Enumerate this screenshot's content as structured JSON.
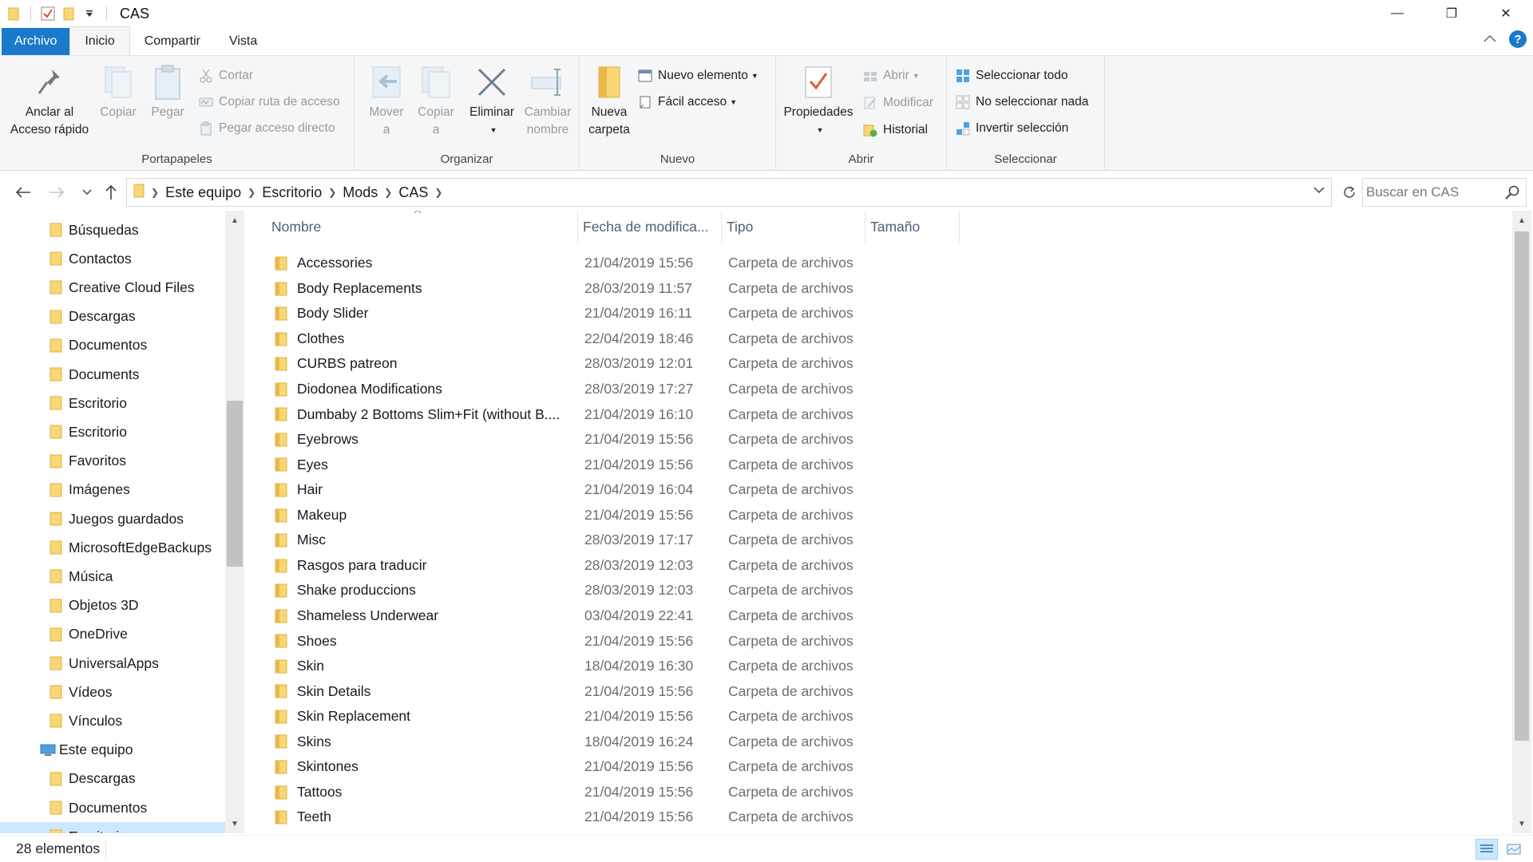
{
  "window": {
    "title": "CAS",
    "controls": {
      "minimize": "—",
      "maximize": "❐",
      "close": "✕"
    }
  },
  "ribbon_tabs": [
    "Archivo",
    "Inicio",
    "Compartir",
    "Vista"
  ],
  "ribbon": {
    "portapapeles": {
      "label": "Portapapeles",
      "pin_line1": "Anclar al",
      "pin_line2": "Acceso rápido",
      "copy": "Copiar",
      "paste": "Pegar",
      "cut": "Cortar",
      "copy_path": "Copiar ruta de acceso",
      "paste_shortcut": "Pegar acceso directo"
    },
    "organizar": {
      "label": "Organizar",
      "move_line1": "Mover",
      "move_line2": "a",
      "copy_line1": "Copiar",
      "copy_line2": "a",
      "delete": "Eliminar",
      "rename_line1": "Cambiar",
      "rename_line2": "nombre"
    },
    "nuevo": {
      "label": "Nuevo",
      "new_folder_line1": "Nueva",
      "new_folder_line2": "carpeta",
      "new_item": "Nuevo elemento",
      "easy_access": "Fácil acceso"
    },
    "abrir": {
      "label": "Abrir",
      "properties": "Propiedades",
      "open": "Abrir",
      "edit": "Modificar",
      "history": "Historial"
    },
    "seleccionar": {
      "label": "Seleccionar",
      "select_all": "Seleccionar todo",
      "select_none": "No seleccionar nada",
      "invert": "Invertir selección"
    }
  },
  "address": {
    "crumbs": [
      "Este equipo",
      "Escritorio",
      "Mods",
      "CAS"
    ],
    "search_placeholder": "Buscar en CAS"
  },
  "sidebar": {
    "items": [
      {
        "label": "Búsquedas",
        "icon": "search-folder-icon"
      },
      {
        "label": "Contactos",
        "icon": "contacts-folder-icon"
      },
      {
        "label": "Creative Cloud Files",
        "icon": "creative-cloud-icon"
      },
      {
        "label": "Descargas",
        "icon": "downloads-folder-icon"
      },
      {
        "label": "Documentos",
        "icon": "documents-folder-icon"
      },
      {
        "label": "Documents",
        "icon": "folder-icon"
      },
      {
        "label": "Escritorio",
        "icon": "desktop-folder-icon"
      },
      {
        "label": "Escritorio",
        "icon": "desktop-folder-icon"
      },
      {
        "label": "Favoritos",
        "icon": "favorites-folder-icon"
      },
      {
        "label": "Imágenes",
        "icon": "pictures-folder-icon"
      },
      {
        "label": "Juegos guardados",
        "icon": "saved-games-folder-icon"
      },
      {
        "label": "MicrosoftEdgeBackups",
        "icon": "folder-icon"
      },
      {
        "label": "Música",
        "icon": "music-folder-icon"
      },
      {
        "label": "Objetos 3D",
        "icon": "3d-objects-folder-icon"
      },
      {
        "label": "OneDrive",
        "icon": "onedrive-folder-icon"
      },
      {
        "label": "UniversalApps",
        "icon": "folder-icon"
      },
      {
        "label": "Vídeos",
        "icon": "videos-folder-icon"
      },
      {
        "label": "Vínculos",
        "icon": "links-folder-icon"
      },
      {
        "label": "Este equipo",
        "icon": "this-pc-icon"
      },
      {
        "label": "Descargas",
        "icon": "downloads-folder-icon"
      },
      {
        "label": "Documentos",
        "icon": "documents-folder-icon"
      },
      {
        "label": "Escritorio",
        "icon": "desktop-folder-icon"
      }
    ]
  },
  "columns": [
    "Nombre",
    "Fecha de modifica...",
    "Tipo",
    "Tamaño"
  ],
  "files": [
    {
      "name": "Accessories",
      "date": "21/04/2019 15:56",
      "type": "Carpeta de archivos"
    },
    {
      "name": "Body Replacements",
      "date": "28/03/2019 11:57",
      "type": "Carpeta de archivos"
    },
    {
      "name": "Body Slider",
      "date": "21/04/2019 16:11",
      "type": "Carpeta de archivos"
    },
    {
      "name": "Clothes",
      "date": "22/04/2019 18:46",
      "type": "Carpeta de archivos"
    },
    {
      "name": "CURBS patreon",
      "date": "28/03/2019 12:01",
      "type": "Carpeta de archivos"
    },
    {
      "name": "Diodonea Modifications",
      "date": "28/03/2019 17:27",
      "type": "Carpeta de archivos"
    },
    {
      "name": "Dumbaby 2 Bottoms Slim+Fit (without B....",
      "date": "21/04/2019 16:10",
      "type": "Carpeta de archivos"
    },
    {
      "name": "Eyebrows",
      "date": "21/04/2019 15:56",
      "type": "Carpeta de archivos"
    },
    {
      "name": "Eyes",
      "date": "21/04/2019 15:56",
      "type": "Carpeta de archivos"
    },
    {
      "name": "Hair",
      "date": "21/04/2019 16:04",
      "type": "Carpeta de archivos"
    },
    {
      "name": "Makeup",
      "date": "21/04/2019 15:56",
      "type": "Carpeta de archivos"
    },
    {
      "name": "Misc",
      "date": "28/03/2019 17:17",
      "type": "Carpeta de archivos"
    },
    {
      "name": "Rasgos para traducir",
      "date": "28/03/2019 12:03",
      "type": "Carpeta de archivos"
    },
    {
      "name": "Shake produccions",
      "date": "28/03/2019 12:03",
      "type": "Carpeta de archivos"
    },
    {
      "name": "Shameless Underwear",
      "date": "03/04/2019 22:41",
      "type": "Carpeta de archivos"
    },
    {
      "name": "Shoes",
      "date": "21/04/2019 15:56",
      "type": "Carpeta de archivos"
    },
    {
      "name": "Skin",
      "date": "18/04/2019 16:30",
      "type": "Carpeta de archivos"
    },
    {
      "name": "Skin Details",
      "date": "21/04/2019 15:56",
      "type": "Carpeta de archivos"
    },
    {
      "name": "Skin Replacement",
      "date": "21/04/2019 15:56",
      "type": "Carpeta de archivos"
    },
    {
      "name": "Skins",
      "date": "18/04/2019 16:24",
      "type": "Carpeta de archivos"
    },
    {
      "name": "Skintones",
      "date": "21/04/2019 15:56",
      "type": "Carpeta de archivos"
    },
    {
      "name": "Tattoos",
      "date": "21/04/2019 15:56",
      "type": "Carpeta de archivos"
    },
    {
      "name": "Teeth",
      "date": "21/04/2019 15:56",
      "type": "Carpeta de archivos"
    }
  ],
  "status": {
    "count": "28 elementos"
  },
  "colors": {
    "accent": "#1979ca",
    "folder": "#f8d775",
    "folder_dark": "#e8b84a",
    "selection": "#cce8ff"
  }
}
